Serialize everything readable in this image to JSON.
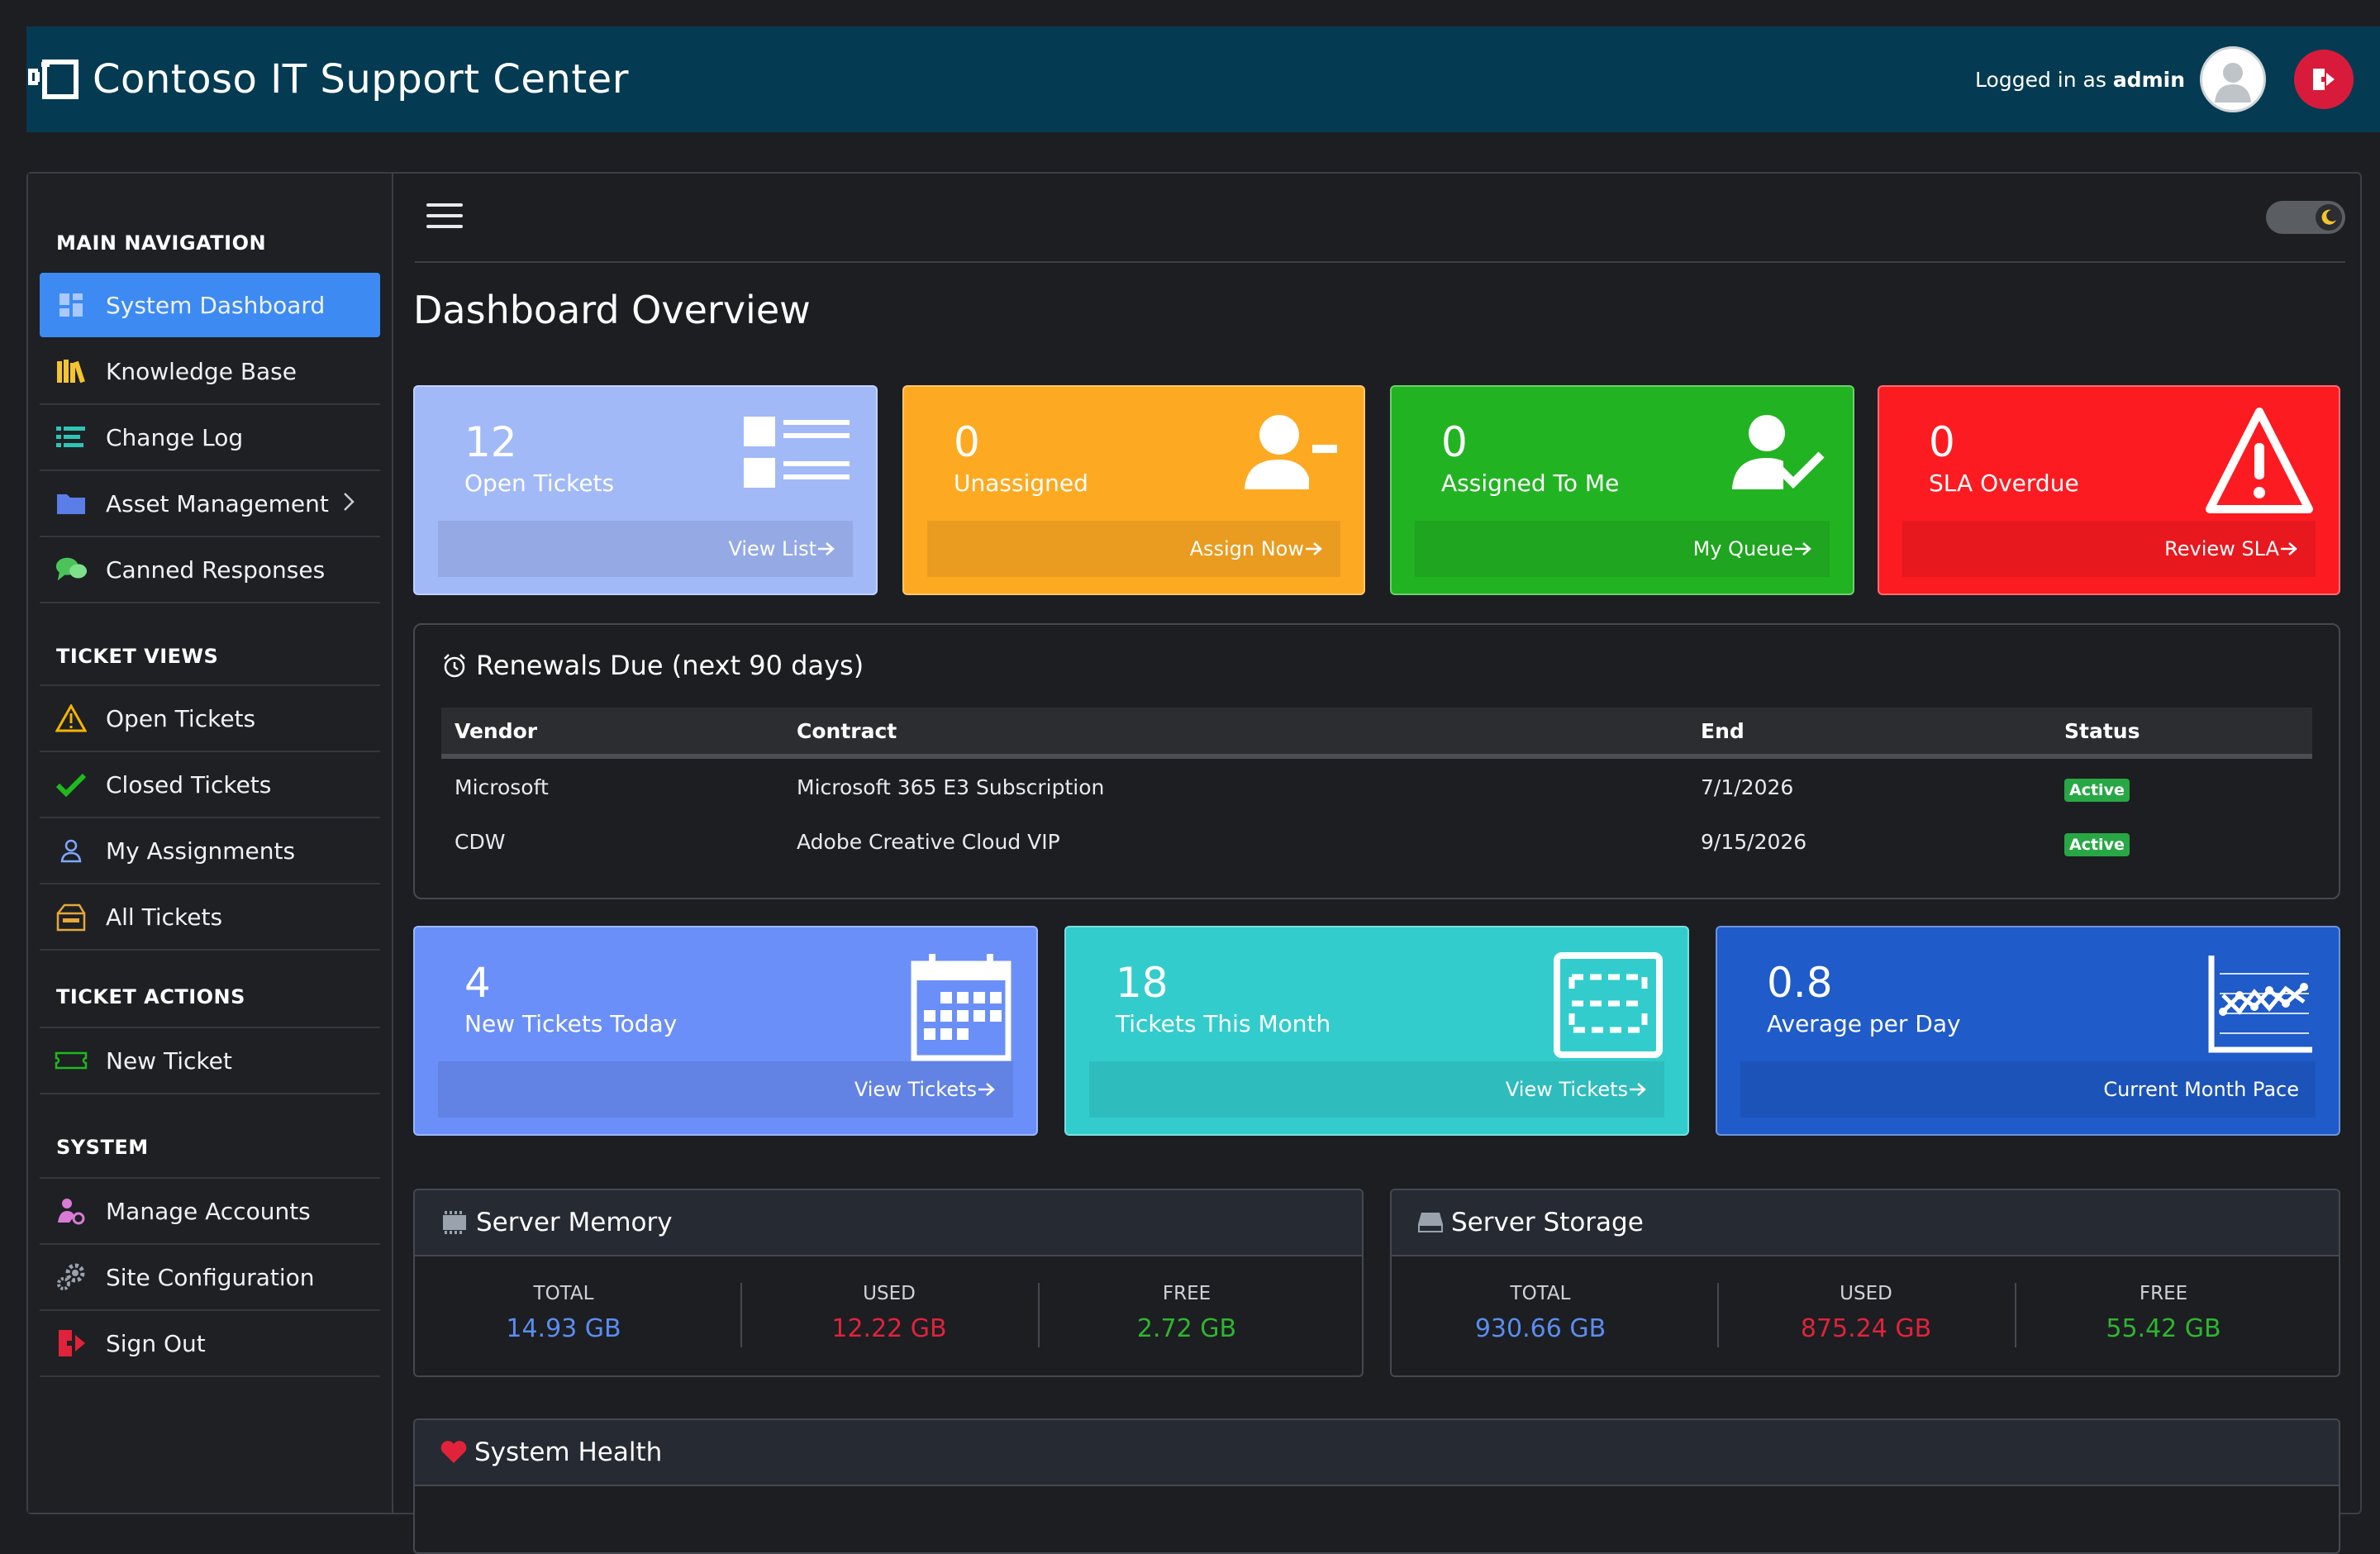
{
  "header": {
    "title": "Contoso IT Support Center",
    "login_prefix": "Logged in as",
    "user": "admin"
  },
  "sidebar": {
    "sections": [
      {
        "title": "MAIN NAVIGATION"
      },
      {
        "title": "TICKET VIEWS"
      },
      {
        "title": "TICKET ACTIONS"
      },
      {
        "title": "SYSTEM"
      }
    ],
    "items": [
      {
        "label": "System Dashboard",
        "icon": "dashboard-icon",
        "active": true
      },
      {
        "label": "Knowledge Base",
        "icon": "books-icon"
      },
      {
        "label": "Change Log",
        "icon": "list-icon"
      },
      {
        "label": "Asset Management",
        "icon": "folder-icon"
      },
      {
        "label": "Canned Responses",
        "icon": "chat-icon"
      },
      {
        "label": "Open Tickets",
        "icon": "warning-icon"
      },
      {
        "label": "Closed Tickets",
        "icon": "check-icon"
      },
      {
        "label": "My Assignments",
        "icon": "user-icon"
      },
      {
        "label": "All Tickets",
        "icon": "open-box-icon"
      },
      {
        "label": "New Ticket",
        "icon": "ticket-icon"
      },
      {
        "label": "Manage Accounts",
        "icon": "account-settings-icon"
      },
      {
        "label": "Site Configuration",
        "icon": "gears-icon"
      },
      {
        "label": "Sign Out",
        "icon": "sign-out-icon"
      }
    ]
  },
  "main": {
    "page_title": "Dashboard Overview",
    "stats": [
      {
        "value": "12",
        "caption": "Open Tickets",
        "link": "View List",
        "color": "#a2b9f8"
      },
      {
        "value": "0",
        "caption": "Unassigned",
        "link": "Assign Now",
        "color": "#fdaa22"
      },
      {
        "value": "0",
        "caption": "Assigned To Me",
        "link": "My Queue",
        "color": "#22b322"
      },
      {
        "value": "0",
        "caption": "SLA Overdue",
        "link": "Review SLA",
        "color": "#fb1b21"
      }
    ],
    "renewals": {
      "title": "Renewals Due (next 90 days)",
      "columns": [
        "Vendor",
        "Contract",
        "End",
        "Status"
      ],
      "rows": [
        {
          "vendor": "Microsoft",
          "contract": "Microsoft 365 E3 Subscription",
          "end": "7/1/2026",
          "status": "Active"
        },
        {
          "vendor": "CDW",
          "contract": "Adobe Creative Cloud VIP",
          "end": "9/15/2026",
          "status": "Active"
        }
      ]
    },
    "stats2": [
      {
        "value": "4",
        "caption": "New Tickets Today",
        "link": "View Tickets",
        "color": "#6b8ff8"
      },
      {
        "value": "18",
        "caption": "Tickets This Month",
        "link": "View Tickets",
        "color": "#33cccc"
      },
      {
        "value": "0.8",
        "caption": "Average per Day",
        "link": "Current Month Pace",
        "color": "#1f5bc9"
      }
    ],
    "memory": {
      "title": "Server Memory",
      "total_label": "TOTAL",
      "total": "14.93 GB",
      "used_label": "USED",
      "used": "12.22 GB",
      "free_label": "FREE",
      "free": "2.72 GB"
    },
    "storage": {
      "title": "Server Storage",
      "total_label": "TOTAL",
      "total": "930.66 GB",
      "used_label": "USED",
      "used": "875.24 GB",
      "free_label": "FREE",
      "free": "55.42 GB"
    },
    "health": {
      "title": "System Health"
    }
  },
  "colors": {
    "header_bg": "#053b52",
    "accent": "#3d8bf2",
    "total": "#5b8df0",
    "used": "#e0233a",
    "free": "#2fb52f"
  }
}
